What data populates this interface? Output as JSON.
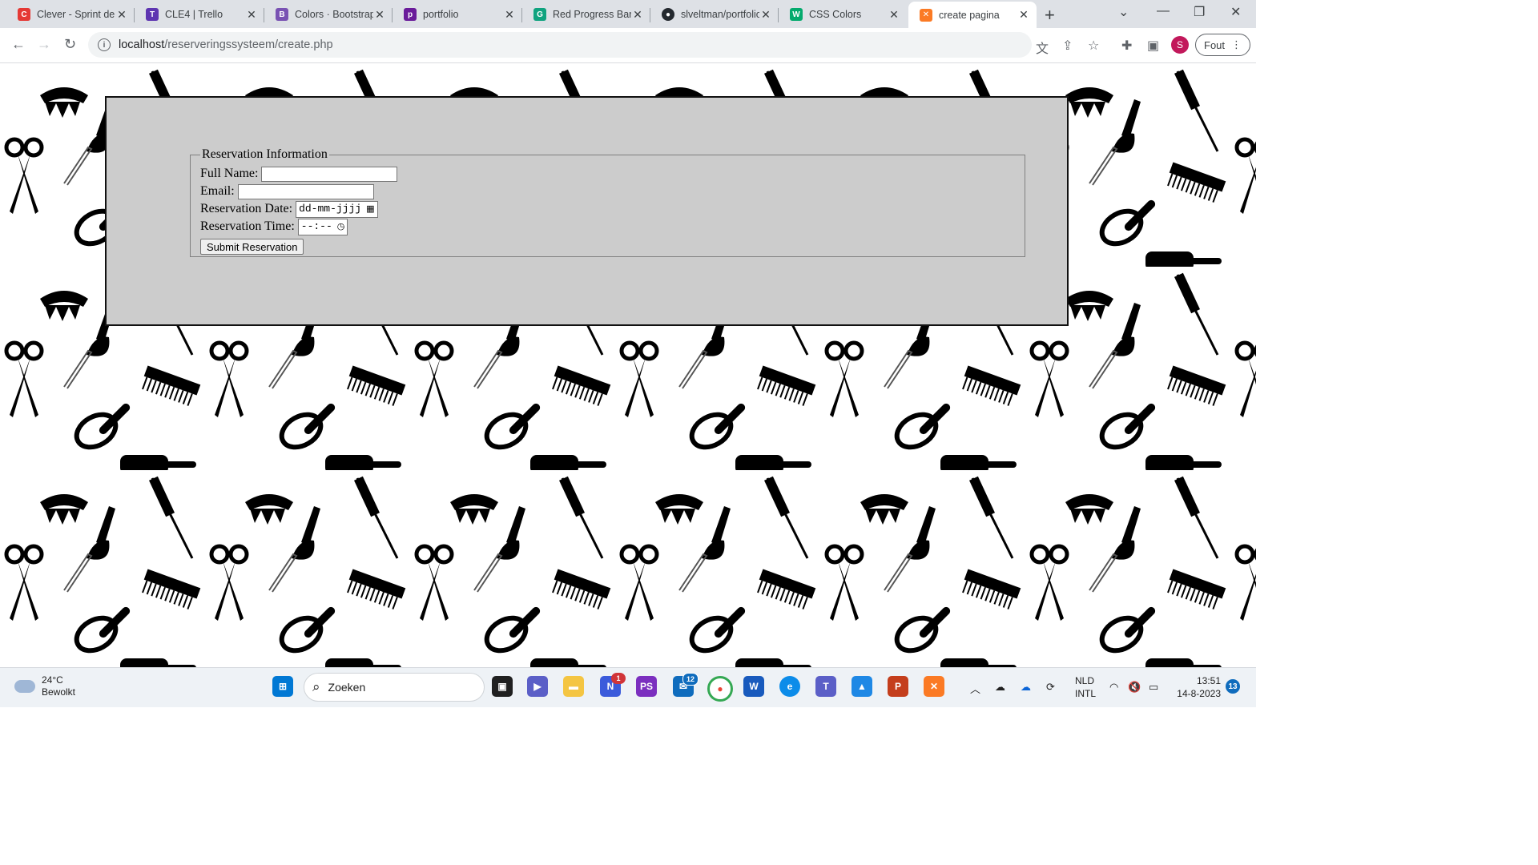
{
  "browser": {
    "tabs": [
      {
        "title": "Clever - Sprint de",
        "icon": "clever-icon",
        "color": "#e53935",
        "glyph": "C"
      },
      {
        "title": "CLE4 | Trello",
        "icon": "trello-icon",
        "color": "#5e35b1",
        "glyph": "T"
      },
      {
        "title": "Colors · Bootstrap",
        "icon": "bootstrap-icon",
        "color": "#7952b3",
        "glyph": "B"
      },
      {
        "title": "portfolio",
        "icon": "portfolio-icon",
        "color": "#6a1b9a",
        "glyph": "p"
      },
      {
        "title": "Red Progress Bar",
        "icon": "chatgpt-icon",
        "color": "#10a37f",
        "glyph": "G"
      },
      {
        "title": "slveltman/portfolio",
        "icon": "github-icon",
        "color": "#24292f",
        "glyph": "⌥"
      },
      {
        "title": "CSS Colors",
        "icon": "w3schools-icon",
        "color": "#04aa6d",
        "glyph": "W"
      },
      {
        "title": "create pagina",
        "icon": "xampp-icon",
        "color": "#fb7a24",
        "glyph": "✕",
        "active": true
      }
    ],
    "url_host": "localhost",
    "url_path": "/reserveringssysteem/create.php",
    "profile_initial": "S",
    "error_label": "Fout"
  },
  "form": {
    "legend": "Reservation Information",
    "full_name_label": "Full Name:",
    "email_label": "Email:",
    "date_label": "Reservation Date:",
    "date_placeholder": "dd-mm-jjjj",
    "time_label": "Reservation Time:",
    "time_placeholder": "--:--",
    "submit_label": "Submit Reservation"
  },
  "taskbar": {
    "temperature": "24°C",
    "weather": "Bewolkt",
    "search_placeholder": "Zoeken",
    "language": "NLD",
    "layout": "INTL",
    "time": "13:51",
    "date": "14-8-2023",
    "notifications": "13",
    "badges": {
      "onenote": "1",
      "mail": "12"
    }
  }
}
